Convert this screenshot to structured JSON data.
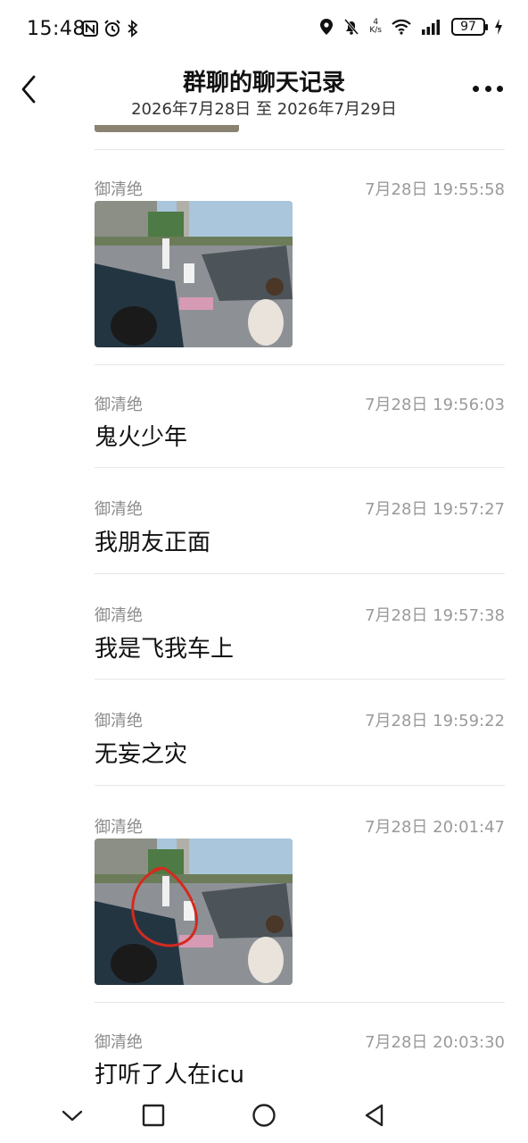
{
  "status_bar": {
    "time": "15:48",
    "net_speed_value": "4",
    "net_speed_unit": "K/s",
    "battery": "97",
    "icons": [
      "nfc-icon",
      "alarm-icon",
      "bluetooth-icon",
      "location-icon",
      "mute-icon",
      "wifi-icon",
      "signal-icon",
      "charging-icon"
    ]
  },
  "header": {
    "title": "群聊的聊天记录",
    "subtitle": "2026年7月28日 至 2026年7月29日",
    "back_icon": "chevron-left-icon",
    "more_icon": "more-dots-icon"
  },
  "messages": [
    {
      "sender": "御清绝",
      "time": "7月28日 19:55:58",
      "type": "image",
      "image": "car-accident-photo"
    },
    {
      "sender": "御清绝",
      "time": "7月28日 19:56:03",
      "type": "text",
      "text": "鬼火少年"
    },
    {
      "sender": "御清绝",
      "time": "7月28日 19:57:27",
      "type": "text",
      "text": "我朋友正面"
    },
    {
      "sender": "御清绝",
      "time": "7月28日 19:57:38",
      "type": "text",
      "text": "我是飞我车上"
    },
    {
      "sender": "御清绝",
      "time": "7月28日 19:59:22",
      "type": "text",
      "text": "无妄之灾"
    },
    {
      "sender": "御清绝",
      "time": "7月28日 20:01:47",
      "type": "image",
      "image": "car-accident-photo-circled"
    },
    {
      "sender": "御清绝",
      "time": "7月28日 20:03:30",
      "type": "text",
      "text": "打听了人在icu"
    }
  ],
  "nav_bar": {
    "icons": [
      "collapse-chevron-icon",
      "recents-square-icon",
      "home-circle-icon",
      "back-triangle-icon"
    ]
  },
  "colors": {
    "background": "#ffffff",
    "divider": "#e6e6e6",
    "sender": "#8b8b8b",
    "timestamp": "#9a9a9a",
    "text": "#111111"
  }
}
